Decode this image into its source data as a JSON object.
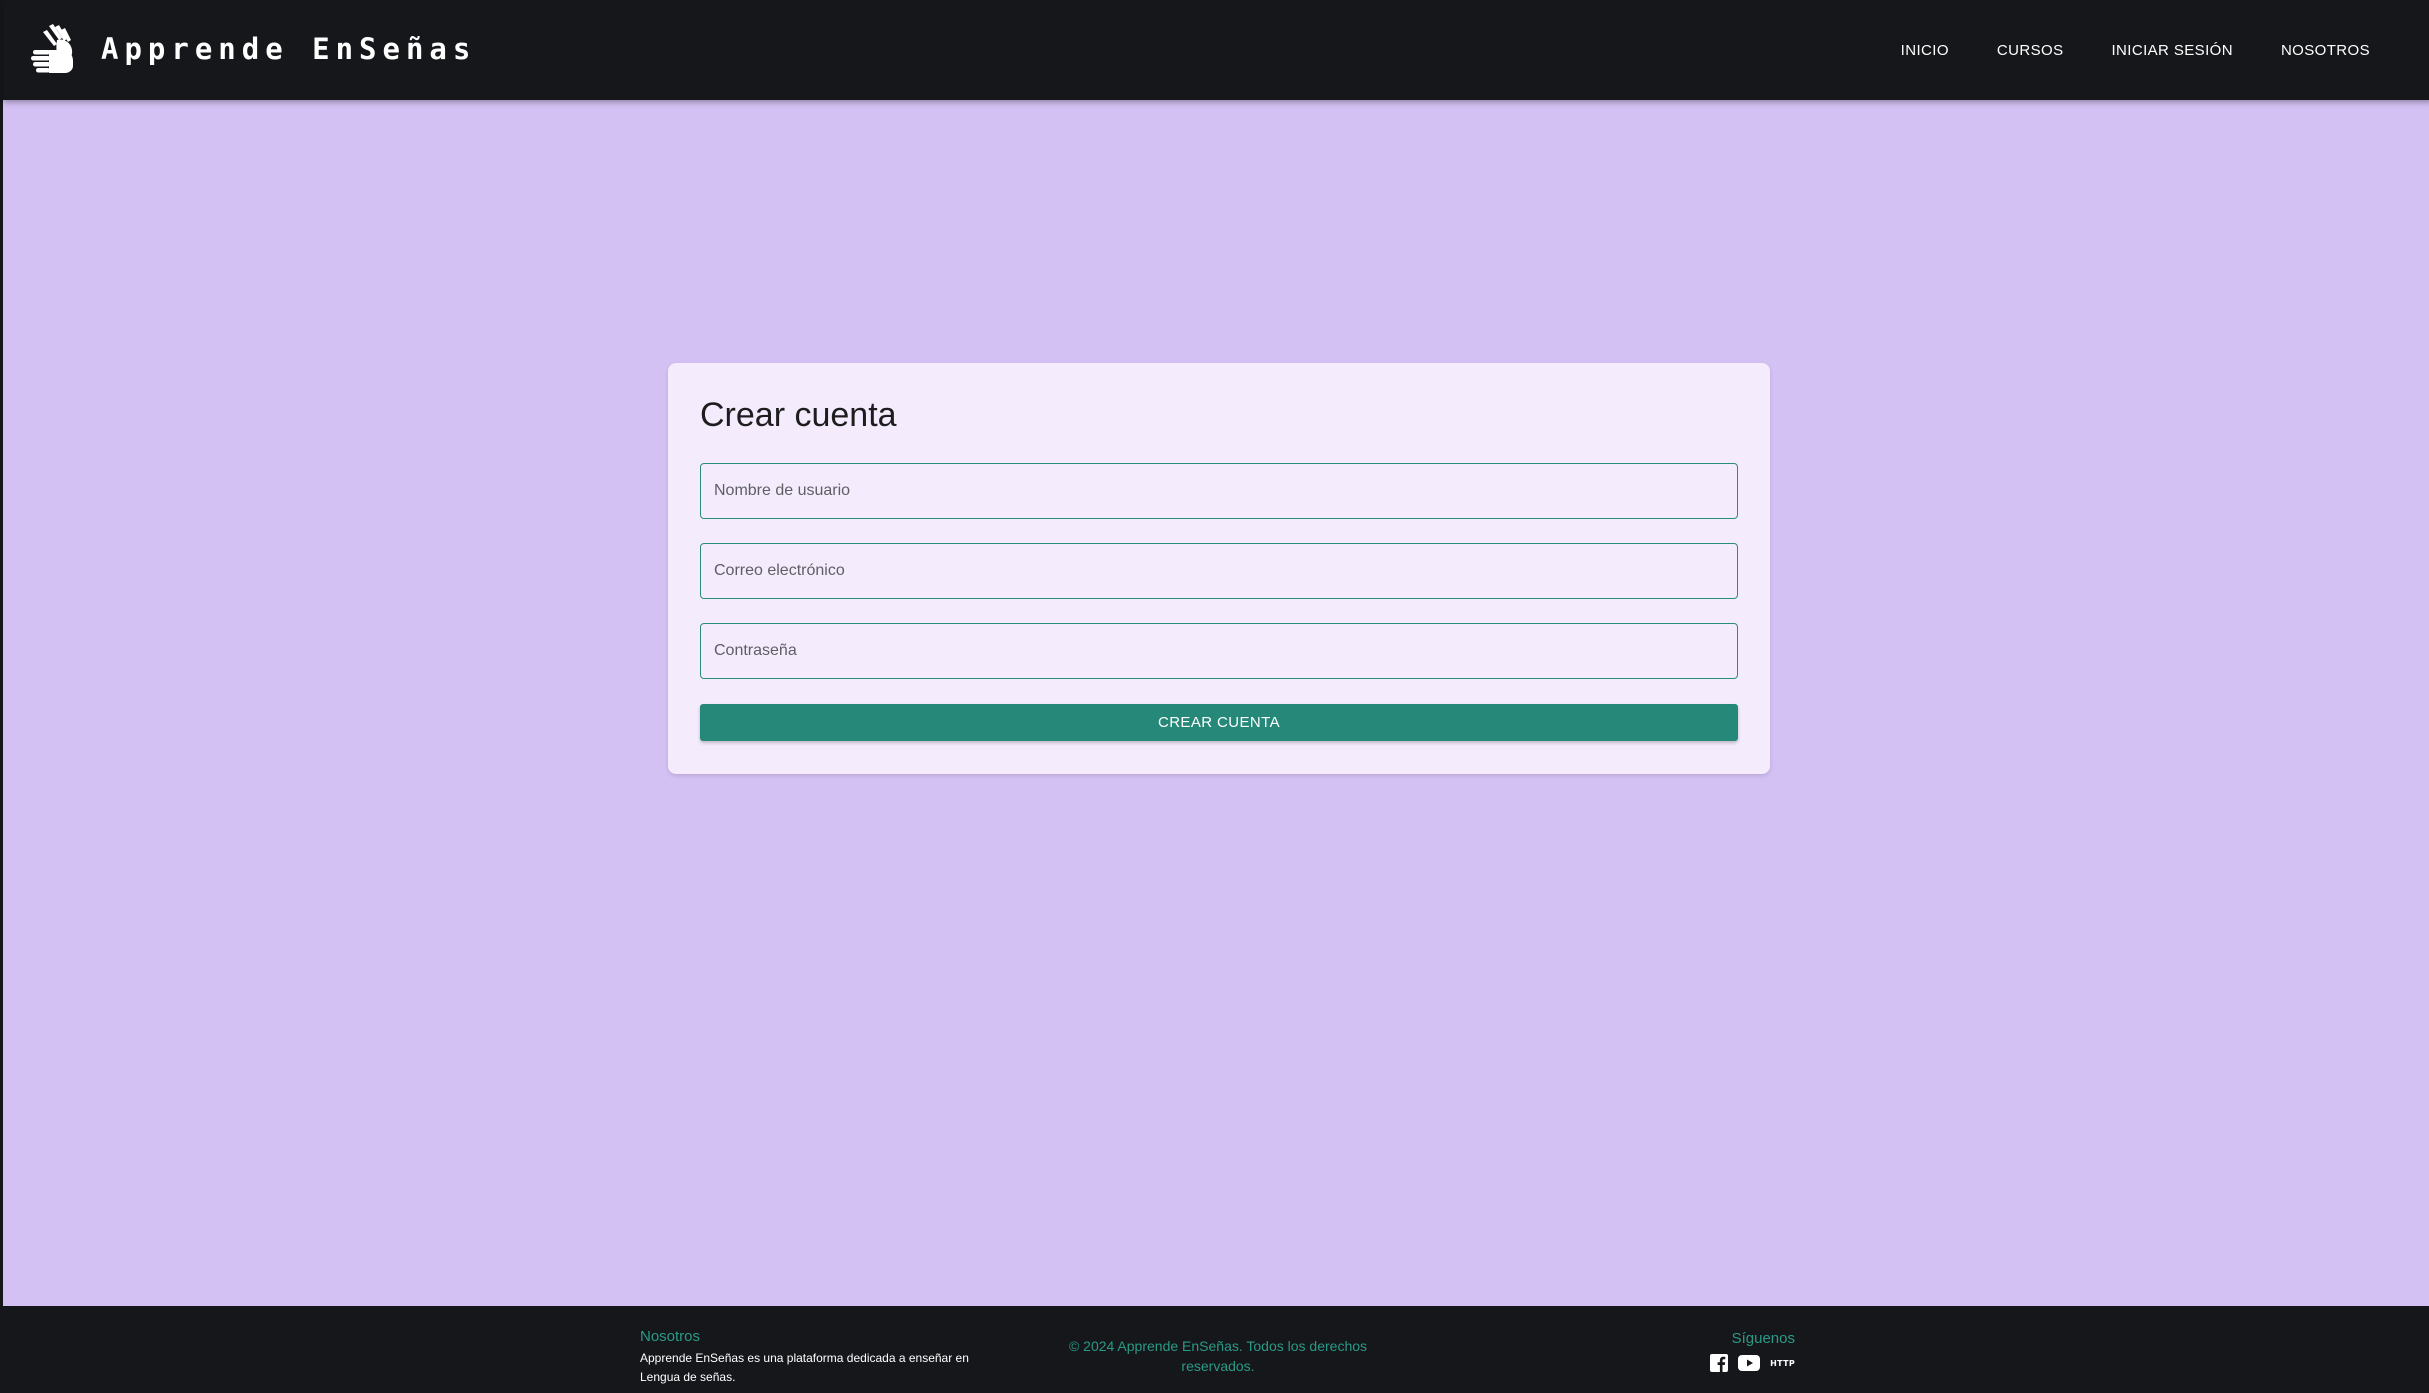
{
  "header": {
    "brand_icon": "sign-language-hands-icon",
    "title": "Apprende EnSeñas",
    "nav": [
      {
        "label": "INICIO"
      },
      {
        "label": "CURSOS"
      },
      {
        "label": "INICIAR SESIÓN"
      },
      {
        "label": "NOSOTROS"
      }
    ]
  },
  "form": {
    "title": "Crear cuenta",
    "username": {
      "value": "",
      "placeholder": "Nombre de usuario"
    },
    "email": {
      "value": "",
      "placeholder": "Correo electrónico"
    },
    "password": {
      "value": "",
      "placeholder": "Contraseña"
    },
    "submit_label": "CREAR CUENTA"
  },
  "footer": {
    "about_heading": "Nosotros",
    "about_text": "Apprende EnSeñas es una plataforma dedicada a enseñar en Lengua de señas.",
    "copyright": "© 2024 Apprende EnSeñas. Todos los derechos reservados.",
    "social_heading": "Síguenos",
    "social": [
      {
        "icon": "facebook-icon"
      },
      {
        "icon": "youtube-icon"
      },
      {
        "icon": "http-icon",
        "label": "HTTP"
      }
    ]
  },
  "colors": {
    "background": "#d4c1f4",
    "header": "#16171b",
    "card": "#f4ecfd",
    "accent": "#268878",
    "footer_accent": "#2a9a86"
  }
}
